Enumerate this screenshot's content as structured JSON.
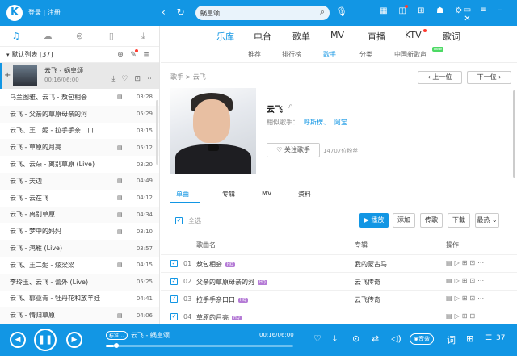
{
  "app": {
    "logo_letter": "K",
    "login": "登录 | 注册",
    "nav_back": "‹",
    "nav_refresh": "↻",
    "search_value": "蜗皇颂",
    "accent_color": "#1296e4"
  },
  "top_icons": [
    "grid-icon",
    "game-icon",
    "shirt-icon",
    "skin-icon",
    "gear-icon"
  ],
  "left_panel": {
    "tab_icons": [
      "music-note-icon",
      "cloud-icon",
      "radio-icon",
      "device-icon",
      "download-icon"
    ],
    "list_title": "默认列表 [37]",
    "current_track": {
      "title": "云飞 - 蜗皇颂",
      "time": "00:16/06:00"
    },
    "tracks": [
      {
        "title": "乌兰图雅、云飞 - 敖包相会",
        "mv": "▤",
        "duration": "03:28"
      },
      {
        "title": "云飞 - 父亲的草原母亲的河",
        "mv": "",
        "duration": "05:29"
      },
      {
        "title": "云飞、王二妮 - 拉手手亲口口",
        "mv": "",
        "duration": "03:15"
      },
      {
        "title": "云飞 - 草原的月亮",
        "mv": "▤",
        "duration": "05:12"
      },
      {
        "title": "云飞、云朵 - 离别草原 (Live)",
        "mv": "",
        "duration": "03:20"
      },
      {
        "title": "云飞 - 天边",
        "mv": "▤",
        "duration": "04:49"
      },
      {
        "title": "云飞 - 云在飞",
        "mv": "▤",
        "duration": "04:12"
      },
      {
        "title": "云飞 - 离别草原",
        "mv": "▤",
        "duration": "04:34"
      },
      {
        "title": "云飞 - 梦中的妈妈",
        "mv": "▤",
        "duration": "03:10"
      },
      {
        "title": "云飞 - 鸿雁 (Live)",
        "mv": "",
        "duration": "03:57"
      },
      {
        "title": "云飞、王二妮 - 炫梁梁",
        "mv": "▤",
        "duration": "04:15"
      },
      {
        "title": "李玲玉、云飞 - 蕾外 (Live)",
        "mv": "",
        "duration": "05:25"
      },
      {
        "title": "云飞、郭亚青 - 牡丹花和放羊娃",
        "mv": "",
        "duration": "04:41"
      },
      {
        "title": "云飞 - 情归草原",
        "mv": "▤",
        "duration": "04:06"
      }
    ]
  },
  "main_tabs": [
    "乐库",
    "电台",
    "歌单",
    "MV",
    "直播",
    "KTV",
    "歌词"
  ],
  "sub_tabs": [
    "推荐",
    "排行榜",
    "歌手",
    "分类",
    "中国新歌声"
  ],
  "sub_tab_badge": "new",
  "artist": {
    "breadcrumb": "歌手 > 云飞",
    "prev_label": "‹ 上一位",
    "next_label": "下一位 ›",
    "name": "云飞",
    "related_label": "相似歌手：",
    "related": [
      "呼斯楞、",
      "阿宝"
    ],
    "follow_label": "♡ 关注歌手",
    "fans": "14707位粉丝"
  },
  "content_tabs": [
    "单曲",
    "专辑",
    "MV",
    "资料"
  ],
  "toolbar": {
    "select_all": "全选",
    "play": "▶ 播放",
    "add": "添加",
    "send": "传歌",
    "download": "下载",
    "sort": "最热 ⌄"
  },
  "table_headers": {
    "name": "歌曲名",
    "album": "专辑",
    "ops": "操作"
  },
  "songs": [
    {
      "num": "01",
      "title": "敖包相会",
      "tag": "HQ",
      "album": "我的蒙古马"
    },
    {
      "num": "02",
      "title": "父亲的草原母亲的河",
      "tag": "HQ",
      "album": "云飞传奇"
    },
    {
      "num": "03",
      "title": "拉手手亲口口",
      "tag": "HQ",
      "album": "云飞传奇"
    },
    {
      "num": "04",
      "title": "草原的月亮",
      "tag": "HQ",
      "album": ""
    }
  ],
  "player": {
    "quality": "标准 ⌄",
    "now_playing": "云飞 - 蜗皇颂",
    "time": "00:16/06:00",
    "progress_fraction": 0.044,
    "sound_label": "◉音效",
    "lyrics_label": "词",
    "list_count": "37"
  }
}
